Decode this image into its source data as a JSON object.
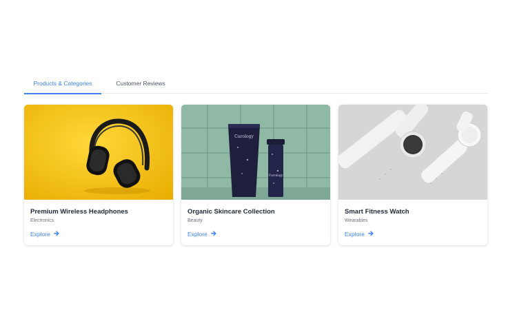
{
  "tabs": [
    {
      "label": "Products & Categories",
      "active": true
    },
    {
      "label": "Customer Reviews",
      "active": false
    }
  ],
  "products": [
    {
      "title": "Premium Wireless Headphones",
      "category": "Electronics",
      "link_label": "Explore",
      "image": "headphones-on-yellow"
    },
    {
      "title": "Organic Skincare Collection",
      "category": "Beauty",
      "link_label": "Explore",
      "image": "skincare-tubes-on-tile"
    },
    {
      "title": "Smart Fitness Watch",
      "category": "Wearables",
      "link_label": "Explore",
      "image": "white-smartwatches-on-grey"
    }
  ],
  "icons": {
    "explore": "arrow-right-icon"
  },
  "colors": {
    "accent": "#3b82f6",
    "headphone_bg": "#f5c518",
    "tile_bg": "#8fb9a4",
    "watch_bg": "#d4d4d4"
  }
}
